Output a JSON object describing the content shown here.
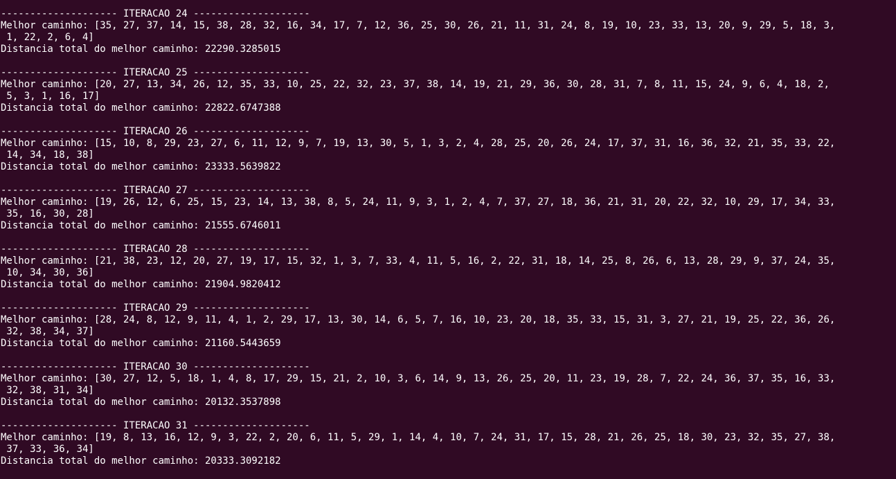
{
  "terminal": {
    "iterations": [
      {
        "header": "-------------------- ITERACAO 24 --------------------",
        "path_line_1": "Melhor caminho: [35, 27, 37, 14, 15, 38, 28, 32, 16, 34, 17, 7, 12, 36, 25, 30, 26, 21, 11, 31, 24, 8, 19, 10, 23, 33, 13, 20, 9, 29, 5, 18, 3,",
        "path_line_2": " 1, 22, 2, 6, 4]",
        "distance": "Distancia total do melhor caminho: 22290.3285015"
      },
      {
        "header": "-------------------- ITERACAO 25 --------------------",
        "path_line_1": "Melhor caminho: [20, 27, 13, 34, 26, 12, 35, 33, 10, 25, 22, 32, 23, 37, 38, 14, 19, 21, 29, 36, 30, 28, 31, 7, 8, 11, 15, 24, 9, 6, 4, 18, 2,",
        "path_line_2": " 5, 3, 1, 16, 17]",
        "distance": "Distancia total do melhor caminho: 22822.6747388"
      },
      {
        "header": "-------------------- ITERACAO 26 --------------------",
        "path_line_1": "Melhor caminho: [15, 10, 8, 29, 23, 27, 6, 11, 12, 9, 7, 19, 13, 30, 5, 1, 3, 2, 4, 28, 25, 20, 26, 24, 17, 37, 31, 16, 36, 32, 21, 35, 33, 22,",
        "path_line_2": " 14, 34, 18, 38]",
        "distance": "Distancia total do melhor caminho: 23333.5639822"
      },
      {
        "header": "-------------------- ITERACAO 27 --------------------",
        "path_line_1": "Melhor caminho: [19, 26, 12, 6, 25, 15, 23, 14, 13, 38, 8, 5, 24, 11, 9, 3, 1, 2, 4, 7, 37, 27, 18, 36, 21, 31, 20, 22, 32, 10, 29, 17, 34, 33,",
        "path_line_2": " 35, 16, 30, 28]",
        "distance": "Distancia total do melhor caminho: 21555.6746011"
      },
      {
        "header": "-------------------- ITERACAO 28 --------------------",
        "path_line_1": "Melhor caminho: [21, 38, 23, 12, 20, 27, 19, 17, 15, 32, 1, 3, 7, 33, 4, 11, 5, 16, 2, 22, 31, 18, 14, 25, 8, 26, 6, 13, 28, 29, 9, 37, 24, 35,",
        "path_line_2": " 10, 34, 30, 36]",
        "distance": "Distancia total do melhor caminho: 21904.9820412"
      },
      {
        "header": "-------------------- ITERACAO 29 --------------------",
        "path_line_1": "Melhor caminho: [28, 24, 8, 12, 9, 11, 4, 1, 2, 29, 17, 13, 30, 14, 6, 5, 7, 16, 10, 23, 20, 18, 35, 33, 15, 31, 3, 27, 21, 19, 25, 22, 36, 26,",
        "path_line_2": " 32, 38, 34, 37]",
        "distance": "Distancia total do melhor caminho: 21160.5443659"
      },
      {
        "header": "-------------------- ITERACAO 30 --------------------",
        "path_line_1": "Melhor caminho: [30, 27, 12, 5, 18, 1, 4, 8, 17, 29, 15, 21, 2, 10, 3, 6, 14, 9, 13, 26, 25, 20, 11, 23, 19, 28, 7, 22, 24, 36, 37, 35, 16, 33,",
        "path_line_2": " 32, 38, 31, 34]",
        "distance": "Distancia total do melhor caminho: 20132.3537898"
      },
      {
        "header": "-------------------- ITERACAO 31 --------------------",
        "path_line_1": "Melhor caminho: [19, 8, 13, 16, 12, 9, 3, 22, 2, 20, 6, 11, 5, 29, 1, 14, 4, 10, 7, 24, 31, 17, 15, 28, 21, 26, 25, 18, 30, 23, 32, 35, 27, 38,",
        "path_line_2": " 37, 33, 36, 34]",
        "distance": "Distancia total do melhor caminho: 20333.3092182"
      }
    ]
  },
  "colors": {
    "background": "#300a24",
    "text": "#ffffff"
  }
}
